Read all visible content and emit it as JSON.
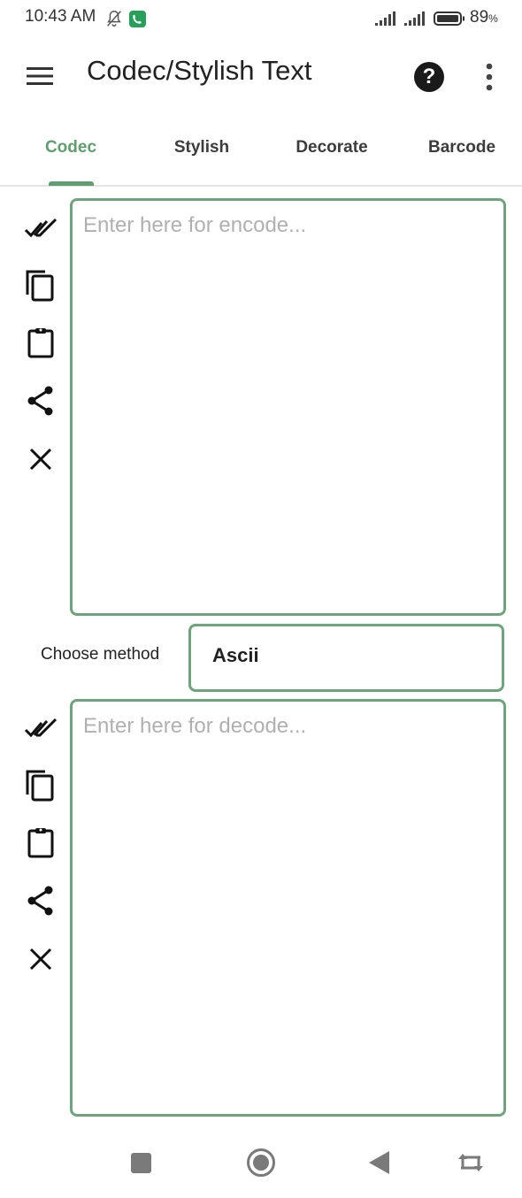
{
  "status_bar": {
    "time": "10:43 AM",
    "battery_percent": "89",
    "battery_unit": "%",
    "icons": [
      "bell-off-icon",
      "call-icon",
      "signal-icon",
      "signal-icon",
      "battery-icon"
    ]
  },
  "app_bar": {
    "title": "Codec/Stylish Text",
    "menu_icon": "hamburger-menu-icon",
    "help_icon": "help-icon",
    "more_icon": "more-vertical-icon"
  },
  "tabs": [
    {
      "label": "Codec",
      "active": true
    },
    {
      "label": "Stylish",
      "active": false
    },
    {
      "label": "Decorate",
      "active": false
    },
    {
      "label": "Barcode",
      "active": false
    }
  ],
  "encode": {
    "placeholder": "Enter here for encode...",
    "value": "",
    "actions": [
      "select-all-icon",
      "copy-icon",
      "paste-icon",
      "share-icon",
      "clear-icon"
    ]
  },
  "method": {
    "label": "Choose method",
    "selected": "Ascii"
  },
  "decode": {
    "placeholder": "Enter here for decode...",
    "value": "",
    "actions": [
      "select-all-icon",
      "copy-icon",
      "paste-icon",
      "share-icon",
      "clear-icon"
    ]
  },
  "nav_bar": [
    "recents-button",
    "home-button",
    "back-button",
    "rotate-button"
  ],
  "colors": {
    "accent": "#5f9e6e",
    "border": "#6ea47b"
  }
}
